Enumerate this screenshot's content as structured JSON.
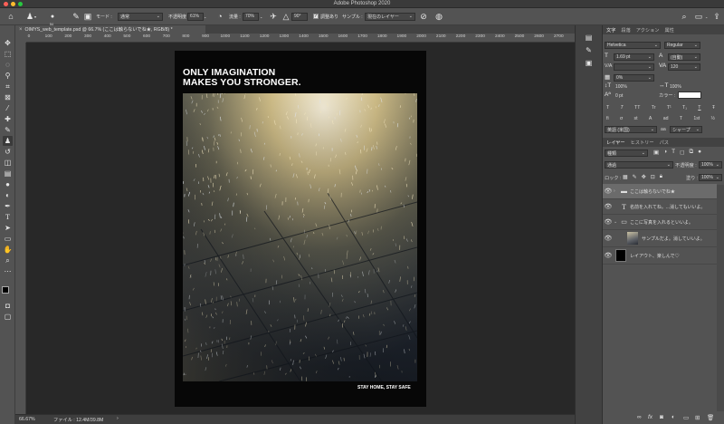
{
  "app": {
    "title": "Adobe Photoshop 2020"
  },
  "options_bar": {
    "brush_size": "54",
    "mode_label": "モード :",
    "mode_value": "通常",
    "opacity_label": "不透明度 :",
    "opacity_value": "61%",
    "flow_label": "流量 :",
    "flow_value": "70%",
    "angle_value": "90°",
    "align_label": "調整あり",
    "sample_label": "サンプル :",
    "sample_value": "現在のレイヤー"
  },
  "document": {
    "tab_close": "×",
    "tab_title": "OIMYS_web_template.psd @ 66.7% (ここは触らないでね★, RGB/8) *",
    "ruler_ticks": [
      "1000",
      "1100",
      "1200",
      "1300",
      "1400",
      "1500",
      "1600",
      "1700",
      "1800",
      "1900",
      "2000",
      "2100",
      "2200",
      "2300",
      "2400",
      "2500",
      "2600",
      "2700"
    ],
    "ruler_ticks_left": [
      "0",
      "100",
      "200",
      "300",
      "400",
      "500",
      "600",
      "700",
      "800",
      "900"
    ],
    "headline_line1": "ONLY IMAGINATION",
    "headline_line2": "MAKES YOU STRONGER.",
    "footer_text": "STAY HOME, STAY SAFE"
  },
  "status_bar": {
    "zoom": "66.67%",
    "file_info": "ファイル : 12.4M/39.8M",
    "arrow": "›"
  },
  "character_panel": {
    "tabs": [
      "文字",
      "段落",
      "アクション",
      "属性"
    ],
    "font_family": "Helvetica",
    "font_style": "Regular",
    "font_size": "1.69 pt",
    "leading": "(自動)",
    "kerning_label": "V/A",
    "kerning_value": "",
    "tracking": "120",
    "baseline_value": "0%",
    "vscale": "100%",
    "hscale": "100%",
    "shift": "0 pt",
    "color_label": "カラー :",
    "color_value": "#ffffff",
    "style_buttons": [
      "T",
      "T",
      "TT",
      "Tr",
      "T¹",
      "T₁",
      "T",
      "Ŧ"
    ],
    "style_buttons_2": [
      "fi",
      "σ",
      "st",
      "A",
      "ad",
      "T",
      "1st",
      "½"
    ],
    "language": "英語 (米国)",
    "aa_label": "aa",
    "antialias": "シャープ"
  },
  "layers_panel": {
    "tabs": [
      "レイヤー",
      "ヒストリー",
      "パス"
    ],
    "filter_value": "種類",
    "blend_mode": "通過",
    "opacity_label": "不透明度 :",
    "opacity_value": "100%",
    "lock_label": "ロック :",
    "fill_label": "塗り :",
    "fill_value": "100%",
    "layers": [
      {
        "name": "ここは触らないでね★",
        "kind": "folder",
        "selected": true
      },
      {
        "name": "名前を入れてね。...消してもいいよ。",
        "kind": "text"
      },
      {
        "name": "ここに写真を入れるといいよ。",
        "kind": "folder"
      },
      {
        "name": "サンプルだよ。消していいよ。",
        "kind": "photo"
      },
      {
        "name": "レイアウト、楽しんで♡",
        "kind": "fill"
      }
    ],
    "bottom_buttons": [
      "link-icon",
      "fx-icon",
      "mask-icon",
      "adjustment-icon",
      "group-icon",
      "new-layer-icon",
      "trash-icon"
    ]
  }
}
